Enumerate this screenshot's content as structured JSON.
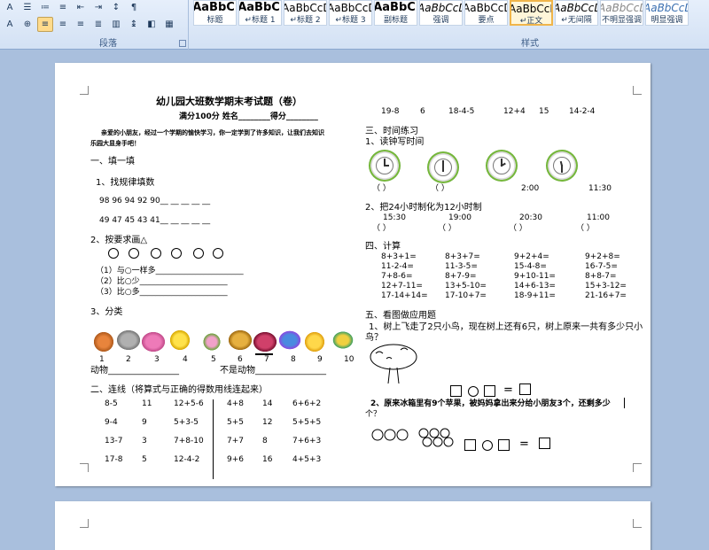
{
  "ribbon": {
    "paragraph_group_label": "段落",
    "styles_group_label": "样式",
    "styles": [
      {
        "sample": "AaBbC",
        "name": "标题"
      },
      {
        "sample": "AaBbC",
        "name": "↵标题 1"
      },
      {
        "sample": "AaBbCcD",
        "name": "↵标题 2"
      },
      {
        "sample": "AaBbCcDd",
        "name": "↵标题 3"
      },
      {
        "sample": "AaBbC",
        "name": "副标题"
      },
      {
        "sample": "AaBbCcDc",
        "name": "强调"
      },
      {
        "sample": "AaBbCcDd",
        "name": "要点"
      },
      {
        "sample": "AaBbCcDc",
        "name": "↵正文"
      },
      {
        "sample": "AaBbCcDc",
        "name": "↵无间隔"
      },
      {
        "sample": "AaBbCcDc",
        "name": "不明显强调"
      },
      {
        "sample": "AaBbCcDc",
        "name": "明显强调"
      }
    ]
  },
  "doc": {
    "title": "幼儿园大班数学期末考试题（卷）",
    "score_line": "满分100分      姓名________得分________",
    "intro_1": "亲爱的小朋友，经过一个学期的愉快学习，你一定学到了许多知识，让我们去知识",
    "intro_2": "乐园大显身手吧！",
    "sec1": "一、填一填",
    "sec1_q1": "1、找规律填数",
    "seq1": "98  96  94  92  90__  __  __  __  __",
    "seq2": "49  47  45  43  41__  __  __  __  __",
    "sec1_q2": "2、按要求画△",
    "draw1": "（1）与○一样多______________________",
    "draw2": "（2）比○少______________________",
    "draw3": "（3）比○多______________________",
    "sec1_q3": "3、分类",
    "class_nums": [
      "1",
      "2",
      "3",
      "4",
      "5",
      "6",
      "7",
      "8",
      "9",
      "10"
    ],
    "animals_label": "动物________________",
    "not_animals_label": "不是动物________________",
    "sec2": "二、连线（将算式与正确的得数用线连起来）",
    "match_rows": [
      [
        "8-5",
        "11",
        "12+5-6",
        "4+8",
        "14",
        "6+6+2"
      ],
      [
        "9-4",
        "9",
        "5+3-5",
        "5+5",
        "12",
        "5+5+5"
      ],
      [
        "13-7",
        "3",
        "7+8-10",
        "7+7",
        "8",
        "7+6+3"
      ],
      [
        "17-8",
        "5",
        "12-4-2",
        "9+6",
        "16",
        "4+5+3"
      ]
    ],
    "top_right_row": [
      "19-8",
      "6",
      "18-4-5",
      "12+4",
      "15",
      "14-2-4"
    ],
    "sec3": "三、时间练习",
    "sec3_q1": "1、读钟写时间",
    "clock_answers": [
      "（      ）",
      "（      ）",
      "2:00",
      "11:30"
    ],
    "sec3_q2": "2、把24小时制化为12小时制",
    "times": [
      "15:30",
      "19:00",
      "20:30",
      "11:00"
    ],
    "time_brackets": [
      "（      ）",
      "（      ）",
      "（      ）",
      "（      ）"
    ],
    "sec4": "四、计算",
    "calc": [
      [
        "8+3+1=",
        "8+3+7=",
        "9+2+4=",
        "9+2+8="
      ],
      [
        "11-2-4=",
        "11-3-5=",
        "15-4-8=",
        "16-7-5="
      ],
      [
        "7+8-6=",
        "8+7-9=",
        "9+10-11=",
        "8+8-7="
      ],
      [
        "12+7-11=",
        "13+5-10=",
        "14+6-13=",
        "15+3-12="
      ],
      [
        "17-14+14=",
        "17-10+7=",
        "18-9+11=",
        "21-16+7="
      ]
    ],
    "sec5": "五、看图做应用题",
    "sec5_q1a": "1、树上飞走了2只小鸟，现在树上还有6只，树上原来一共有多少只小",
    "sec5_q1b": "鸟？",
    "sec5_q2": "2、原来冰箱里有9个苹果，被妈妈拿出来分给小朋友3个，还剩多少",
    "sec5_q2b": "个？",
    "eq": "="
  }
}
